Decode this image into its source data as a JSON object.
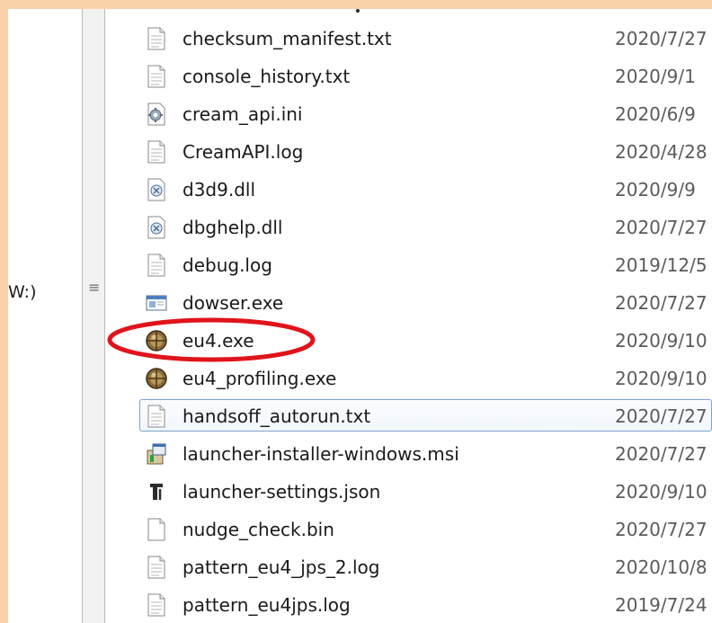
{
  "sidebar": {
    "drive_label": "W:)",
    "grip_symbol": "≡"
  },
  "files": [
    {
      "name": "checksum_manifest.txt",
      "date": "2020/7/27",
      "icon": "text-file-icon"
    },
    {
      "name": "console_history.txt",
      "date": "2020/9/1",
      "icon": "text-file-icon"
    },
    {
      "name": "cream_api.ini",
      "date": "2020/6/9",
      "icon": "config-file-icon"
    },
    {
      "name": "CreamAPI.log",
      "date": "2020/4/28",
      "icon": "text-file-icon"
    },
    {
      "name": "d3d9.dll",
      "date": "2020/9/9",
      "icon": "dll-file-icon"
    },
    {
      "name": "dbghelp.dll",
      "date": "2020/7/27",
      "icon": "dll-file-icon"
    },
    {
      "name": "debug.log",
      "date": "2019/12/5",
      "icon": "text-file-icon"
    },
    {
      "name": "dowser.exe",
      "date": "2020/7/27",
      "icon": "window-app-icon"
    },
    {
      "name": "eu4.exe",
      "date": "2020/9/10",
      "icon": "eu4-globe-icon"
    },
    {
      "name": "eu4_profiling.exe",
      "date": "2020/9/10",
      "icon": "eu4-globe-icon"
    },
    {
      "name": "handsoff_autorun.txt",
      "date": "2020/7/27",
      "icon": "text-file-icon"
    },
    {
      "name": "launcher-installer-windows.msi",
      "date": "2020/7/27",
      "icon": "installer-package-icon"
    },
    {
      "name": "launcher-settings.json",
      "date": "2020/9/10",
      "icon": "json-file-icon"
    },
    {
      "name": "nudge_check.bin",
      "date": "2020/7/27",
      "icon": "blank-file-icon"
    },
    {
      "name": "pattern_eu4_jps_2.log",
      "date": "2020/10/8",
      "icon": "text-file-icon"
    },
    {
      "name": "pattern_eu4jps.log",
      "date": "2019/7/24",
      "icon": "text-file-icon"
    }
  ],
  "colors": {
    "background": "#fbd3aa",
    "highlight_circle": "#e0141c",
    "selection_border": "#7da2ce"
  }
}
